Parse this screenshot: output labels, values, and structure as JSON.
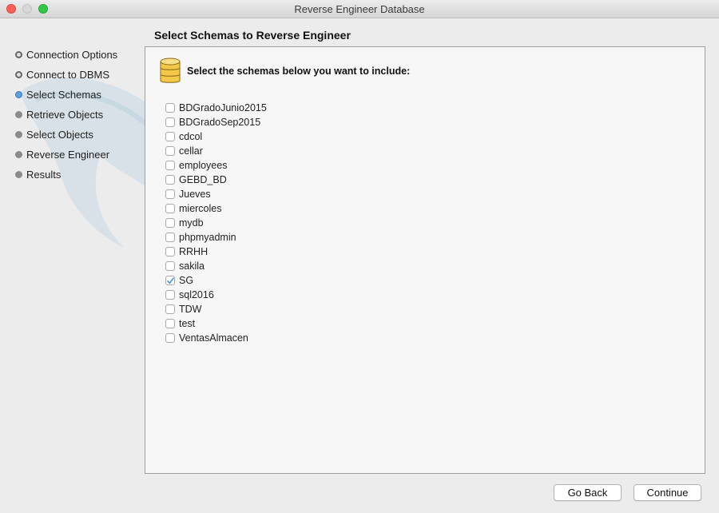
{
  "window": {
    "title": "Reverse Engineer Database"
  },
  "steps": [
    {
      "label": "Connection Options",
      "state": "done"
    },
    {
      "label": "Connect to DBMS",
      "state": "done"
    },
    {
      "label": "Select Schemas",
      "state": "active"
    },
    {
      "label": "Retrieve Objects",
      "state": "pending"
    },
    {
      "label": "Select Objects",
      "state": "pending"
    },
    {
      "label": "Reverse Engineer",
      "state": "pending"
    },
    {
      "label": "Results",
      "state": "pending"
    }
  ],
  "main": {
    "heading": "Select Schemas to Reverse Engineer",
    "instruction": "Select the schemas below you want to include:",
    "icon": "database-icon",
    "schemas": [
      {
        "name": "BDGradoJunio2015",
        "checked": false
      },
      {
        "name": "BDGradoSep2015",
        "checked": false
      },
      {
        "name": "cdcol",
        "checked": false
      },
      {
        "name": "cellar",
        "checked": false
      },
      {
        "name": "employees",
        "checked": false
      },
      {
        "name": "GEBD_BD",
        "checked": false
      },
      {
        "name": "Jueves",
        "checked": false
      },
      {
        "name": "miercoles",
        "checked": false
      },
      {
        "name": "mydb",
        "checked": false
      },
      {
        "name": "phpmyadmin",
        "checked": false
      },
      {
        "name": "RRHH",
        "checked": false
      },
      {
        "name": "sakila",
        "checked": false
      },
      {
        "name": "SG",
        "checked": true
      },
      {
        "name": "sql2016",
        "checked": false
      },
      {
        "name": "TDW",
        "checked": false
      },
      {
        "name": "test",
        "checked": false
      },
      {
        "name": "VentasAlmacen",
        "checked": false
      }
    ]
  },
  "buttons": {
    "back": "Go Back",
    "continue": "Continue"
  },
  "colors": {
    "accent": "#3b8ee8",
    "close": "#fc5f57",
    "zoom": "#34c748"
  }
}
